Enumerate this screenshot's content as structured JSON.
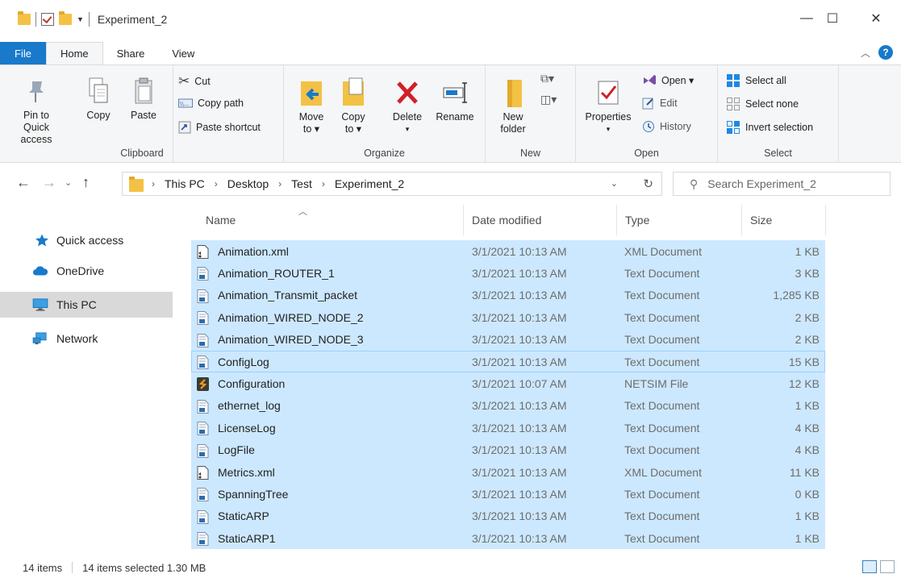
{
  "window": {
    "title": "Experiment_2",
    "controls": {
      "minimize": "—",
      "maximize": "☐",
      "close": "✕"
    }
  },
  "ribbon_tabs": [
    {
      "label": "File"
    },
    {
      "label": "Home"
    },
    {
      "label": "Share"
    },
    {
      "label": "View"
    }
  ],
  "ribbon": {
    "clipboard": {
      "group_label": "Clipboard",
      "pin_line1": "Pin to Quick",
      "pin_line2": "access",
      "copy": "Copy",
      "paste": "Paste",
      "cut": "Cut",
      "copy_path": "Copy path",
      "paste_shortcut": "Paste shortcut"
    },
    "organize": {
      "group_label": "Organize",
      "move_line1": "Move",
      "move_line2": "to ▾",
      "copy_line1": "Copy",
      "copy_line2": "to ▾",
      "delete": "Delete",
      "delete_caret": "▾",
      "rename": "Rename"
    },
    "new": {
      "group_label": "New",
      "folder_line1": "New",
      "folder_line2": "folder"
    },
    "open": {
      "group_label": "Open",
      "properties": "Properties",
      "properties_caret": "▾",
      "open": "Open ▾",
      "edit": "Edit",
      "history": "History"
    },
    "select": {
      "group_label": "Select",
      "select_all": "Select all",
      "select_none": "Select none",
      "invert": "Invert selection"
    }
  },
  "address": {
    "crumbs": [
      "This PC",
      "Desktop",
      "Test",
      "Experiment_2"
    ],
    "search_placeholder": "Search Experiment_2"
  },
  "nav": {
    "items": [
      {
        "label": "Quick access",
        "icon": "star-icon"
      },
      {
        "label": "OneDrive",
        "icon": "cloud-icon"
      },
      {
        "label": "This PC",
        "icon": "monitor-icon",
        "selected": true
      },
      {
        "label": "Network",
        "icon": "network-icon"
      }
    ]
  },
  "columns": {
    "name": "Name",
    "date": "Date modified",
    "type": "Type",
    "size": "Size"
  },
  "files": [
    {
      "name": "Animation.xml",
      "date": "3/1/2021 10:13 AM",
      "type": "XML Document",
      "size": "1 KB",
      "icon": "xml"
    },
    {
      "name": "Animation_ROUTER_1",
      "date": "3/1/2021 10:13 AM",
      "type": "Text Document",
      "size": "3 KB",
      "icon": "txt"
    },
    {
      "name": "Animation_Transmit_packet",
      "date": "3/1/2021 10:13 AM",
      "type": "Text Document",
      "size": "1,285 KB",
      "icon": "txt"
    },
    {
      "name": "Animation_WIRED_NODE_2",
      "date": "3/1/2021 10:13 AM",
      "type": "Text Document",
      "size": "2 KB",
      "icon": "txt"
    },
    {
      "name": "Animation_WIRED_NODE_3",
      "date": "3/1/2021 10:13 AM",
      "type": "Text Document",
      "size": "2 KB",
      "icon": "txt"
    },
    {
      "name": "ConfigLog",
      "date": "3/1/2021 10:13 AM",
      "type": "Text Document",
      "size": "15 KB",
      "icon": "txt",
      "focused": true
    },
    {
      "name": "Configuration",
      "date": "3/1/2021 10:07 AM",
      "type": "NETSIM File",
      "size": "12 KB",
      "icon": "netsim"
    },
    {
      "name": "ethernet_log",
      "date": "3/1/2021 10:13 AM",
      "type": "Text Document",
      "size": "1 KB",
      "icon": "txt"
    },
    {
      "name": "LicenseLog",
      "date": "3/1/2021 10:13 AM",
      "type": "Text Document",
      "size": "4 KB",
      "icon": "txt"
    },
    {
      "name": "LogFile",
      "date": "3/1/2021 10:13 AM",
      "type": "Text Document",
      "size": "4 KB",
      "icon": "txt"
    },
    {
      "name": "Metrics.xml",
      "date": "3/1/2021 10:13 AM",
      "type": "XML Document",
      "size": "11 KB",
      "icon": "xml"
    },
    {
      "name": "SpanningTree",
      "date": "3/1/2021 10:13 AM",
      "type": "Text Document",
      "size": "0 KB",
      "icon": "txt"
    },
    {
      "name": "StaticARP",
      "date": "3/1/2021 10:13 AM",
      "type": "Text Document",
      "size": "1 KB",
      "icon": "txt"
    },
    {
      "name": "StaticARP1",
      "date": "3/1/2021 10:13 AM",
      "type": "Text Document",
      "size": "1 KB",
      "icon": "txt"
    }
  ],
  "status": {
    "count": "14 items",
    "selected": "14 items selected  1.30 MB"
  }
}
